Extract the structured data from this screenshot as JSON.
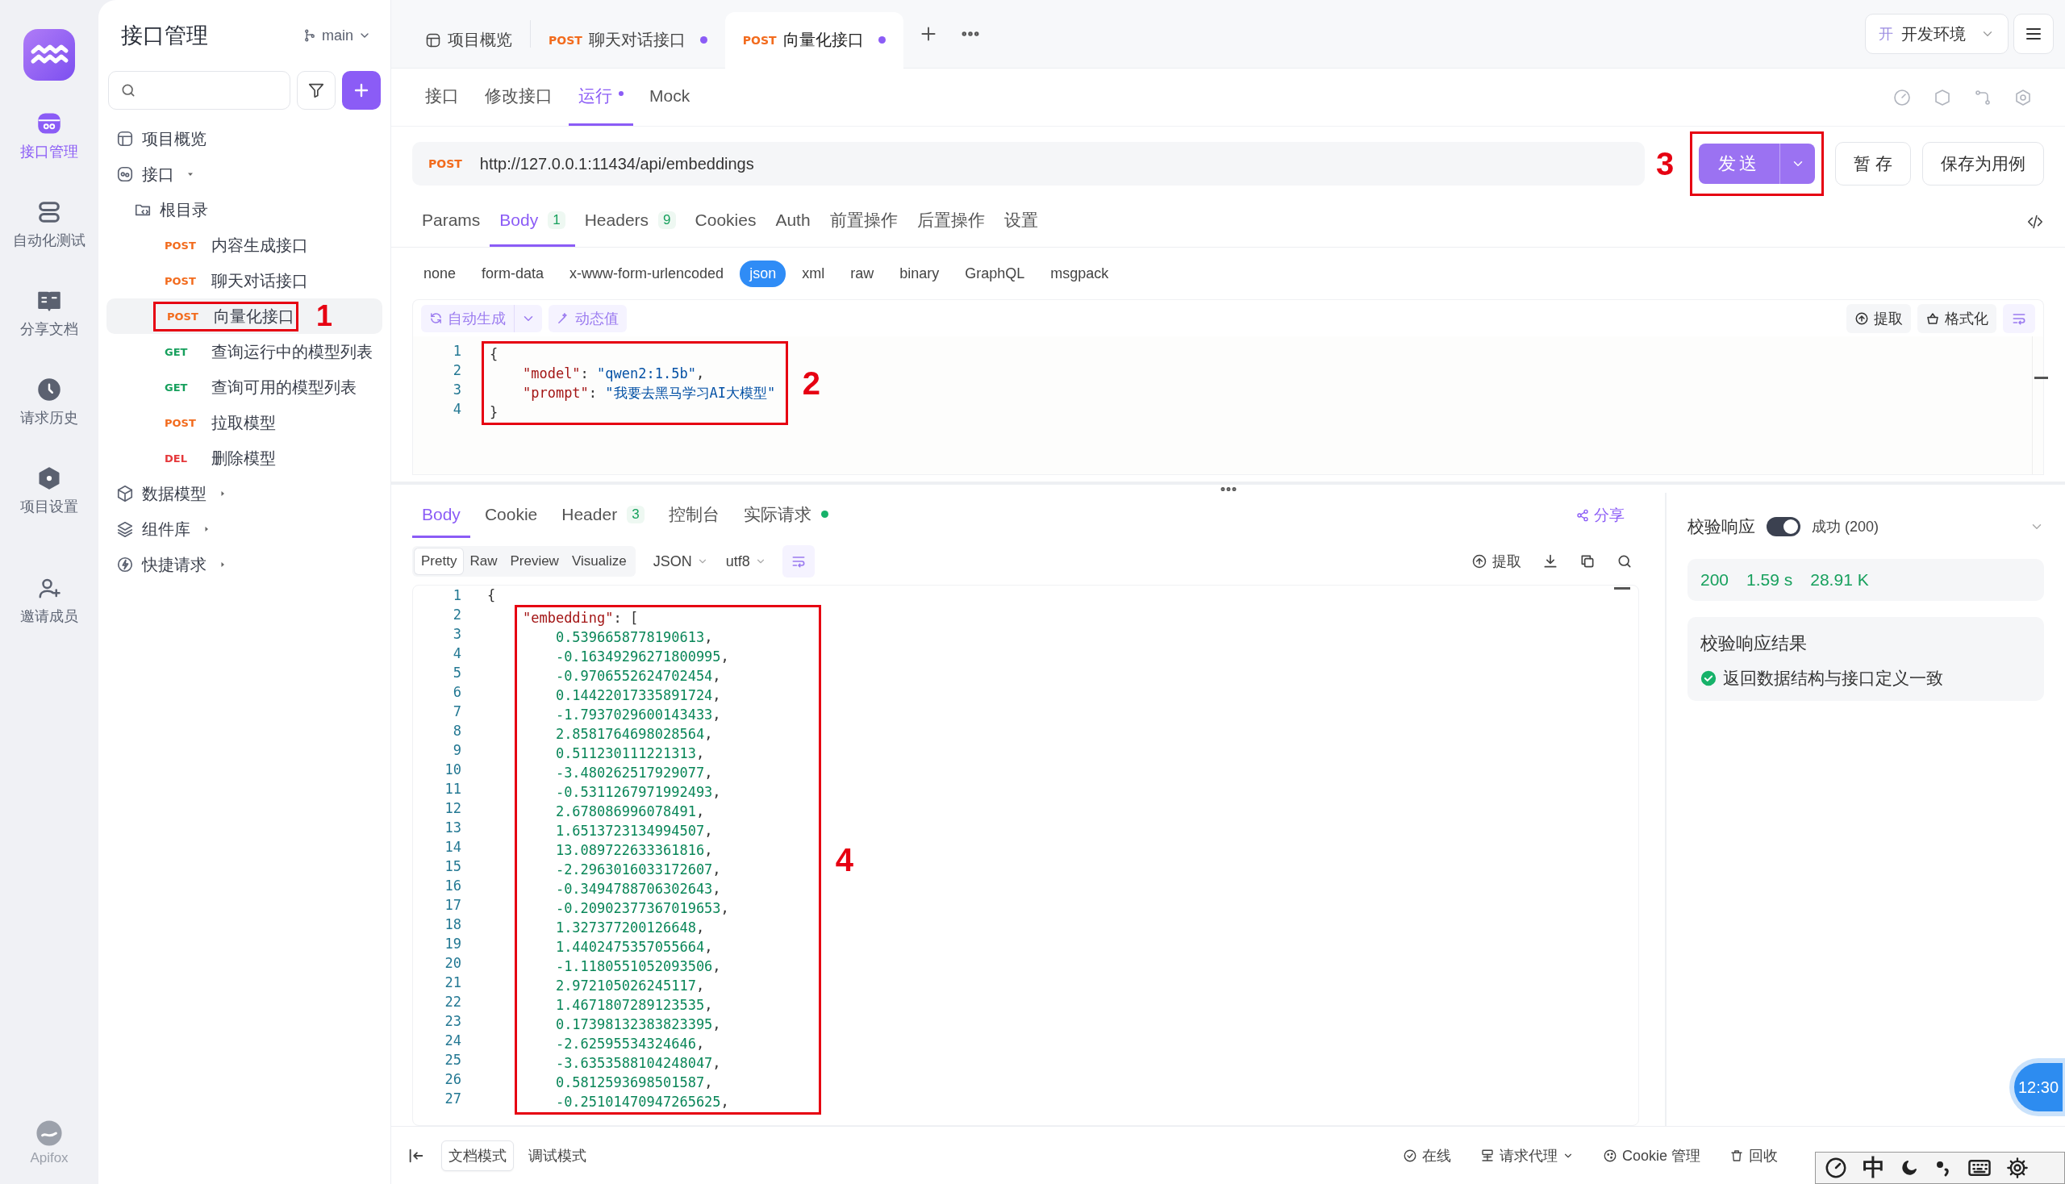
{
  "rail": {
    "items": [
      {
        "kind": "api",
        "label": "接口管理",
        "selected": true
      },
      {
        "kind": "tests",
        "label": "自动化测试",
        "selected": false
      },
      {
        "kind": "docs",
        "label": "分享文档",
        "selected": false
      },
      {
        "kind": "history",
        "label": "请求历史",
        "selected": false
      },
      {
        "kind": "settings",
        "label": "项目设置",
        "selected": false
      },
      {
        "kind": "invite",
        "label": "邀请成员",
        "selected": false
      }
    ],
    "brand": "Apifox"
  },
  "sidebar": {
    "title": "接口管理",
    "branch": "main",
    "tree": [
      {
        "kind": "overview",
        "label": "项目概览"
      },
      {
        "kind": "api",
        "label": "接口",
        "expanded": true,
        "children": [
          {
            "kind": "folder",
            "label": "根目录",
            "children": [
              {
                "kind": "endpoint",
                "method": "POST",
                "color": "#f26b1d",
                "label": "内容生成接口",
                "selected": false
              },
              {
                "kind": "endpoint",
                "method": "POST",
                "color": "#f26b1d",
                "label": "聊天对话接口",
                "selected": false
              },
              {
                "kind": "endpoint",
                "method": "POST",
                "color": "#f26b1d",
                "label": "向量化接口",
                "selected": true,
                "annotation": "1"
              },
              {
                "kind": "endpoint",
                "method": "GET",
                "color": "#17a05d",
                "label": "查询运行中的模型列表",
                "selected": false
              },
              {
                "kind": "endpoint",
                "method": "GET",
                "color": "#17a05d",
                "label": "查询可用的模型列表",
                "selected": false
              },
              {
                "kind": "endpoint",
                "method": "POST",
                "color": "#f26b1d",
                "label": "拉取模型",
                "selected": false
              },
              {
                "kind": "endpoint",
                "method": "DEL",
                "color": "#e5383b",
                "label": "删除模型",
                "selected": false
              }
            ]
          }
        ]
      },
      {
        "kind": "model",
        "label": "数据模型",
        "expanded": false
      },
      {
        "kind": "component",
        "label": "组件库",
        "expanded": false
      },
      {
        "kind": "quick",
        "label": "快捷请求",
        "expanded": false
      }
    ]
  },
  "tabs": [
    {
      "kind": "overview",
      "label": "项目概览",
      "selected": false
    },
    {
      "kind": "endpoint",
      "method": "POST",
      "color": "#f26b1d",
      "label": "聊天对话接口",
      "modified": true,
      "selected": false
    },
    {
      "kind": "endpoint",
      "method": "POST",
      "color": "#f26b1d",
      "label": "向量化接口",
      "modified": true,
      "selected": true
    }
  ],
  "environment": {
    "badge": "开",
    "label": "开发环境"
  },
  "request": {
    "subtabs": [
      {
        "label": "接口",
        "selected": false,
        "modified": false
      },
      {
        "label": "修改接口",
        "selected": false,
        "modified": false
      },
      {
        "label": "运行",
        "selected": true,
        "modified": true
      },
      {
        "label": "Mock",
        "selected": false,
        "modified": false
      }
    ],
    "method": "POST",
    "url": "http://127.0.0.1:11434/api/embeddings",
    "send": "发送",
    "send_annotation": "3",
    "save": "暂 存",
    "save_case": "保存为用例",
    "param_tabs": [
      {
        "label": "Params",
        "selected": false
      },
      {
        "label": "Body",
        "count": "1",
        "selected": true
      },
      {
        "label": "Headers",
        "count": "9",
        "selected": false
      },
      {
        "label": "Cookies",
        "selected": false
      },
      {
        "label": "Auth",
        "selected": false
      },
      {
        "label": "前置操作",
        "selected": false
      },
      {
        "label": "后置操作",
        "selected": false
      },
      {
        "label": "设置",
        "selected": false
      }
    ],
    "body_types": [
      {
        "label": "none",
        "selected": false
      },
      {
        "label": "form-data",
        "selected": false
      },
      {
        "label": "x-www-form-urlencoded",
        "selected": false
      },
      {
        "label": "json",
        "selected": true
      },
      {
        "label": "xml",
        "selected": false
      },
      {
        "label": "raw",
        "selected": false
      },
      {
        "label": "binary",
        "selected": false
      },
      {
        "label": "GraphQL",
        "selected": false
      },
      {
        "label": "msgpack",
        "selected": false
      }
    ],
    "tools": {
      "auto": "自动生成",
      "dynamic": "动态值",
      "extract": "提取",
      "format": "格式化"
    },
    "editor": {
      "annotation": "2",
      "lines": [
        {
          "n": "1",
          "code": "{",
          "boxed": true
        },
        {
          "n": "2",
          "code": "    \"model\": \"qwen2:1.5b\",",
          "boxed": true
        },
        {
          "n": "3",
          "code": "    \"prompt\": \"我要去黑马学习AI大模型\"",
          "boxed": true
        },
        {
          "n": "4",
          "code": "}",
          "boxed": true
        }
      ]
    }
  },
  "response": {
    "tabs": [
      {
        "label": "Body",
        "selected": true
      },
      {
        "label": "Cookie",
        "selected": false
      },
      {
        "label": "Header",
        "count": "3",
        "selected": false
      },
      {
        "label": "控制台",
        "selected": false
      },
      {
        "label": "实际请求",
        "selected": false,
        "status_dot": true
      }
    ],
    "share": "分享",
    "views": [
      {
        "label": "Pretty",
        "selected": true
      },
      {
        "label": "Raw",
        "selected": false
      },
      {
        "label": "Preview",
        "selected": false
      },
      {
        "label": "Visualize",
        "selected": false
      }
    ],
    "format": "JSON",
    "encoding": "utf8",
    "extract": "提取",
    "editor": {
      "annotation": "4",
      "lines": [
        {
          "n": "1",
          "code": "{",
          "boxed": false
        },
        {
          "n": "2",
          "code": "    \"embedding\": [",
          "boxed": true
        },
        {
          "n": "3",
          "code": "        0.5396658778190613,",
          "boxed": true
        },
        {
          "n": "4",
          "code": "        -0.16349296271800995,",
          "boxed": true
        },
        {
          "n": "5",
          "code": "        -0.9706552624702454,",
          "boxed": true
        },
        {
          "n": "6",
          "code": "        0.14422017335891724,",
          "boxed": true
        },
        {
          "n": "7",
          "code": "        -1.7937029600143433,",
          "boxed": true
        },
        {
          "n": "8",
          "code": "        2.8581764698028564,",
          "boxed": true
        },
        {
          "n": "9",
          "code": "        0.511230111221313,",
          "boxed": true
        },
        {
          "n": "10",
          "code": "        -3.480262517929077,",
          "boxed": true
        },
        {
          "n": "11",
          "code": "        -0.5311267971992493,",
          "boxed": true
        },
        {
          "n": "12",
          "code": "        2.678086996078491,",
          "boxed": true
        },
        {
          "n": "13",
          "code": "        1.6513723134994507,",
          "boxed": true
        },
        {
          "n": "14",
          "code": "        13.089722633361816,",
          "boxed": true
        },
        {
          "n": "15",
          "code": "        -2.2963016033172607,",
          "boxed": true
        },
        {
          "n": "16",
          "code": "        -0.3494788706302643,",
          "boxed": true
        },
        {
          "n": "17",
          "code": "        -0.20902377367019653,",
          "boxed": true
        },
        {
          "n": "18",
          "code": "        1.327377200126648,",
          "boxed": true
        },
        {
          "n": "19",
          "code": "        1.4402475357055664,",
          "boxed": true
        },
        {
          "n": "20",
          "code": "        -1.1180551052093506,",
          "boxed": true
        },
        {
          "n": "21",
          "code": "        2.972105026245117,",
          "boxed": true
        },
        {
          "n": "22",
          "code": "        1.4671807289123535,",
          "boxed": true
        },
        {
          "n": "23",
          "code": "        0.17398132383823395,",
          "boxed": true
        },
        {
          "n": "24",
          "code": "        -2.62595534324646,",
          "boxed": true
        },
        {
          "n": "25",
          "code": "        -3.6353588104248047,",
          "boxed": true
        },
        {
          "n": "26",
          "code": "        0.5812593698501587,",
          "boxed": true
        },
        {
          "n": "27",
          "code": "        -0.25101470947265625,",
          "boxed": true
        }
      ]
    }
  },
  "validation": {
    "title": "校验响应",
    "enabled": true,
    "result_label": "成功 (200)",
    "status": "200",
    "time": "1.59 s",
    "size": "28.91 K",
    "result_title": "校验响应结果",
    "result": "返回数据结构与接口定义一致",
    "passed": true
  },
  "status_bar": {
    "modes": [
      {
        "label": "文档模式",
        "selected": true
      },
      {
        "label": "调试模式",
        "selected": false
      }
    ],
    "items": [
      {
        "kind": "online",
        "label": "在线"
      },
      {
        "kind": "proxy",
        "label": "请求代理"
      },
      {
        "kind": "cookie",
        "label": "Cookie 管理"
      },
      {
        "kind": "trash",
        "label": "回收"
      }
    ]
  },
  "overlay": {
    "clock": "12:30",
    "ime": "中"
  }
}
